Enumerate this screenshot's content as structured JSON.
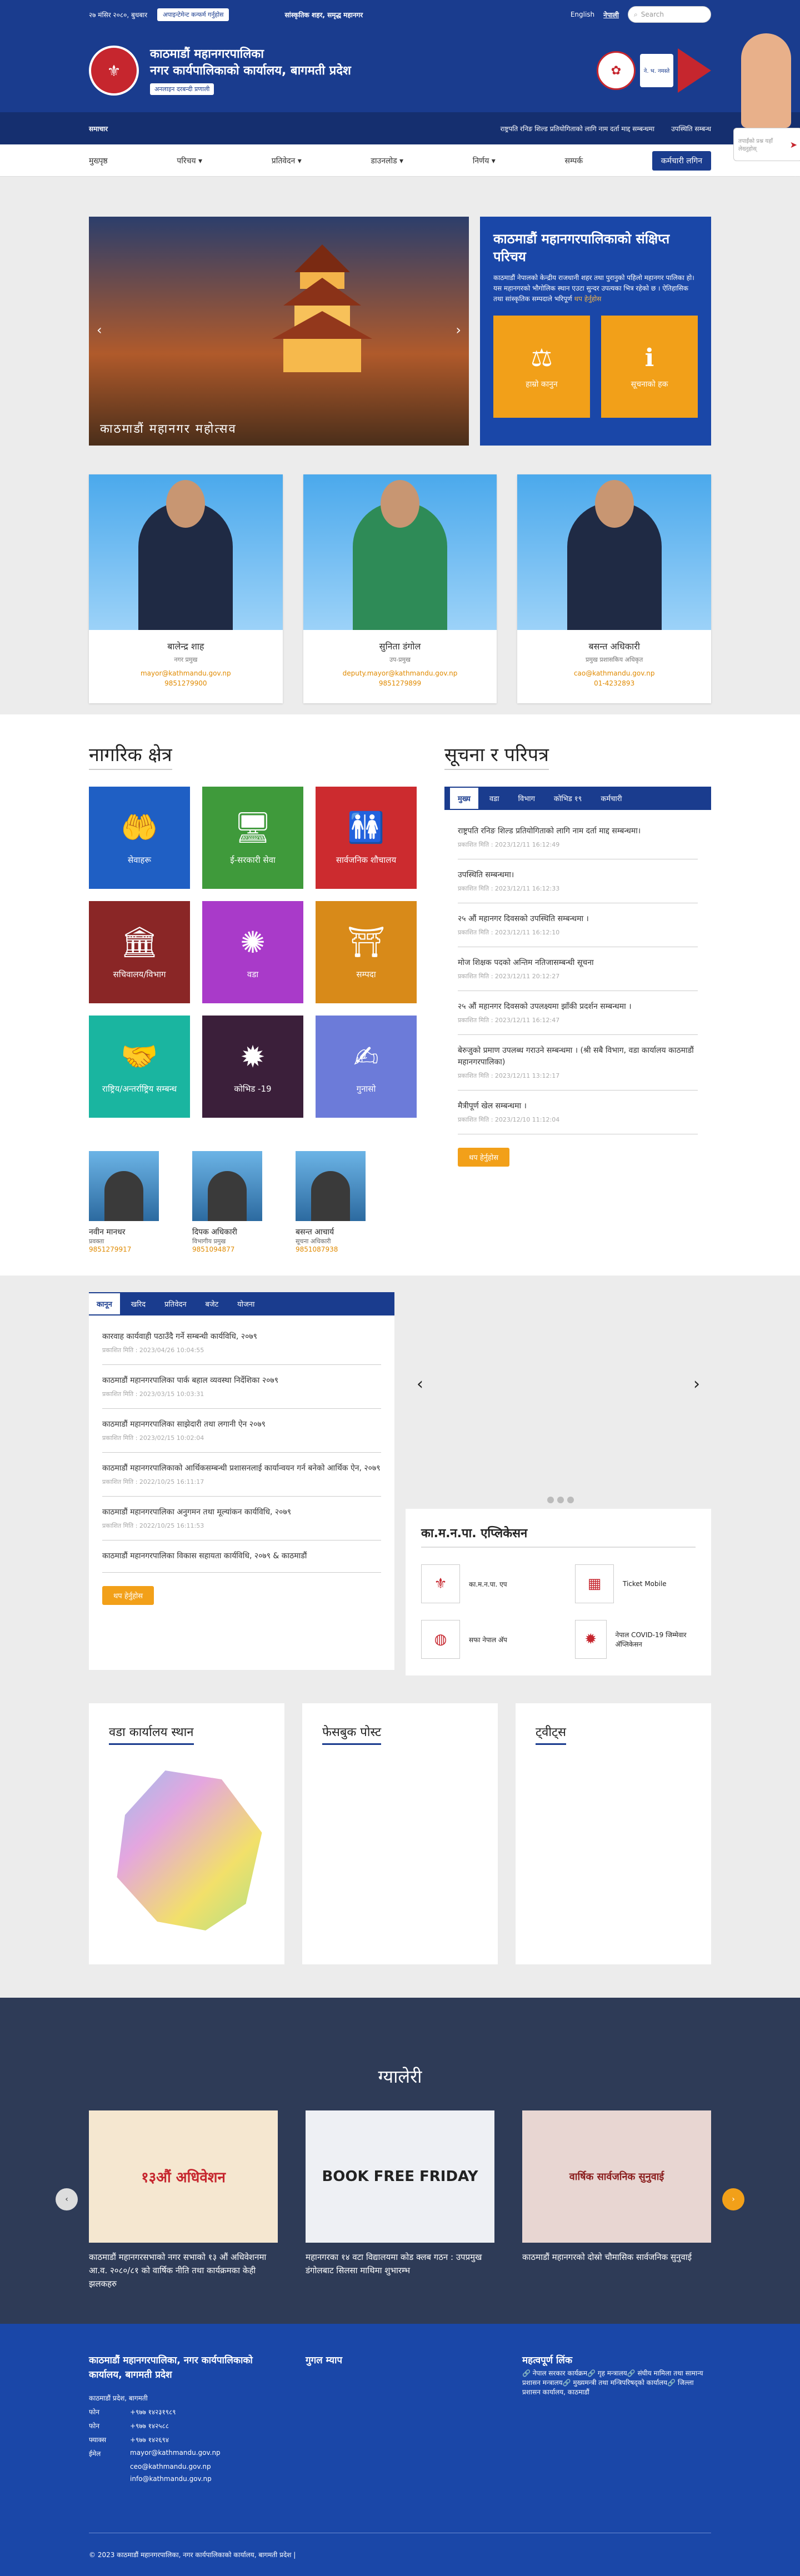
{
  "topbar": {
    "date": "२७ मंसिर २०८०, बुधबार",
    "appointment": "अपाइन्टेमेन्ट कन्फर्म गर्नुहोस",
    "tagline": "सांस्कृतिक शहर, समृद्ध महानगर",
    "english": "English",
    "nepali": "नेपाली",
    "search_placeholder": "Search"
  },
  "brand": {
    "line1": "काठमाडौं महानगरपालिका",
    "line2": "नगर कार्यपालिकाको कार्यालय, बागमती प्रदेश",
    "chip": "अनलाइन दरबन्दी प्रणाली",
    "pillar": "ने. भ. नमस्ते"
  },
  "ticker": {
    "label": "समाचार",
    "items": [
      "राष्ट्रपति रनिङ शिल्ड प्रतियोगिताको लागि नाम दर्ता माद्द सम्बन्धमा",
      "उपस्थिति सम्बन्ध"
    ]
  },
  "nav": [
    "मुख्पृष्ठ",
    "परिचय ▾",
    "प्रतिवेदन ▾",
    "डाउनलोड ▾",
    "निर्णय ▾",
    "सम्पर्क"
  ],
  "nav_login": "कर्मचारी लगिन",
  "slider": {
    "caption": "काठमाडौं महानगर महोत्सव"
  },
  "intro": {
    "title": "काठमाडौं महानगरपालिकाको संक्षिप्त परिचय",
    "text": "काठमाडौं नेपालको केन्द्रीय राजधानी शहर तथा पुरानुको पहिलो महानगर पालिका हो। यस महानगरको भौगोलिक स्थान एउटा सुन्दर उपत्यका भित्र रहेको छ । ऐतिहासिक तथा सांस्कृतिक सम्पदाले भरिपूर्ण",
    "more": "थप हेर्नुहोस",
    "box1": "हाम्रो कानुन",
    "box2": "सूचनाको हक"
  },
  "officials": [
    {
      "name": "बालेन्द्र शाह",
      "role": "नगर प्रमुख",
      "mail": "mayor@kathmandu.gov.np",
      "phone": "9851279900"
    },
    {
      "name": "सुनिता डंगोल",
      "role": "उप-प्रमुख",
      "mail": "deputy.mayor@kathmandu.gov.np",
      "phone": "9851279899"
    },
    {
      "name": "बसन्त अधिकारी",
      "role": "प्रमुख प्रशासकिय अधिकृत",
      "mail": "cao@kathmandu.gov.np",
      "phone": "01-4232893"
    }
  ],
  "helper": {
    "placeholder": "तपाईंको प्रश्न यहाँ लेख्नुहोस्"
  },
  "civic": {
    "title": "नागरिक क्षेत्र",
    "tiles": [
      {
        "label": "सेवाहरू",
        "icon": "🤲",
        "color": "#1f5fc4"
      },
      {
        "label": "ई-सरकारी सेवा",
        "icon": "🖥",
        "color": "#3f9a3b"
      },
      {
        "label": "सार्वजनिक शौचालय",
        "icon": "🚻",
        "color": "#cc2b2f"
      },
      {
        "label": "सचिवालय/विभाग",
        "icon": "🏛",
        "color": "#8a2626"
      },
      {
        "label": "वडा",
        "icon": "✺",
        "color": "#a93ac9"
      },
      {
        "label": "सम्पदा",
        "icon": "⛩",
        "color": "#d88a19"
      },
      {
        "label": "राष्ट्रिय/अन्तर्राष्ट्रिय सम्बन्ध",
        "icon": "🤝",
        "color": "#1ab5a0"
      },
      {
        "label": "कोभिड -19",
        "icon": "✹",
        "color": "#3b1f3a"
      },
      {
        "label": "गुनासो",
        "icon": "✍",
        "color": "#6c7bd9"
      }
    ],
    "staff": [
      {
        "name": "नवीन मानधर",
        "role": "प्रवक्ता",
        "tel": "9851279917"
      },
      {
        "name": "दिपक अधिकारी",
        "role": "विभागीय प्रमुख",
        "tel": "9851094877"
      },
      {
        "name": "बसन्त आचार्य",
        "role": "सूचना अधिकारी",
        "tel": "9851087938"
      }
    ]
  },
  "notice": {
    "title": "सूचना र परिपत्र",
    "tabs": [
      "मुख्य",
      "वडा",
      "विभाग",
      "कोभिड १९",
      "कर्मचारी"
    ],
    "items": [
      {
        "t": "राष्ट्रपति रनिङ शिल्ड प्रतियोगिताको लागि नाम दर्ता माद्द सम्बन्धमा।",
        "d": "प्रकाशित मिति : 2023/12/11 16:12:49"
      },
      {
        "t": "उपस्थिति सम्बन्धमा।",
        "d": "प्रकाशित मिति : 2023/12/11 16:12:33"
      },
      {
        "t": "२५ औं महानगर दिवसको उपस्थिति सम्बन्धमा ।",
        "d": "प्रकाशित मिति : 2023/12/11 16:12:10"
      },
      {
        "t": "मोज शिक्षक पदको अन्तिम नतिजासम्बन्धी सूचना",
        "d": "प्रकाशित मिति : 2023/12/11 20:12:27"
      },
      {
        "t": "२५ औं महानगर दिवसको उपलक्ष्यमा झाँकी प्रदर्शन सम्बन्धमा ।",
        "d": "प्रकाशित मिति : 2023/12/11 16:12:47"
      },
      {
        "t": "बेरुजुको प्रमाण उपलब्ध गराउने सम्बन्धमा । (श्री सबै विभाग, वडा कार्यालय काठमाडौं महानगरपालिका)",
        "d": "प्रकाशित मिति : 2023/12/11 13:12:17"
      },
      {
        "t": "मैत्रीपूर्ण खेल सम्बन्धमा ।",
        "d": "प्रकाशित मिति : 2023/12/10 11:12:04"
      }
    ],
    "more": "थप हेर्नुहोस"
  },
  "law": {
    "tabs": [
      "कानून",
      "खरिद",
      "प्रतिवेदन",
      "बजेट",
      "योजना"
    ],
    "items": [
      {
        "t": "कारवाह कार्यवाही पठाउँदै गर्ने सम्बन्धी कार्यविधि, २०७९",
        "d": "प्रकाशित मिति : 2023/04/26 10:04:55"
      },
      {
        "t": "काठमाडौं महानगरपालिका पार्क बहाल व्यवस्था निर्देशिका २०७९",
        "d": "प्रकाशित मिति : 2023/03/15 10:03:31"
      },
      {
        "t": "काठमाडौं महानगरपालिका साझेदारी तथा लगानी ऐन २०७९",
        "d": "प्रकाशित मिति : 2023/02/15 10:02:04"
      },
      {
        "t": "काठमाडौं महानगरपालिकाको आर्थिकसम्बन्धी प्रशासनलाई कार्यान्वयन गर्न बनेको आर्थिक ऐन, २०७९",
        "d": "प्रकाशित मिति : 2022/10/25 16:11:17"
      },
      {
        "t": "काठमाडौं महानगरपालिका अनुगमन तथा मूल्यांकन कार्यविधि, २०७९",
        "d": "प्रकाशित मिति : 2022/10/25 16:11:53"
      },
      {
        "t": "काठमाडौं महानगरपालिका विकास सहायता कार्यविधि, २०७९ & काठमाडौं",
        "d": ""
      }
    ],
    "more": "थप हेर्नुहोस"
  },
  "apps": {
    "title": "का.म.न.पा. एप्लिकेसन",
    "items": [
      "का.म.न.पा. एप",
      "Ticket Mobile",
      "सफा नेपाल अ‍ॅप",
      "नेपाल COVID-19 जिम्मेवार अ‍ॅप्लिकेसन"
    ]
  },
  "panels": [
    "वडा कार्यालय स्थान",
    "फेसबुक पोस्ट",
    "ट्वीट्स"
  ],
  "gallery": {
    "title": "ग्यालेरी",
    "items": [
      {
        "img": "१३औं अधिवेशन",
        "t": "काठमाडौं महानगरसभाको नगर सभाको १३ औं अधिवेशनमा आ.व. २०८०/८१ को वार्षिक नीति तथा कार्यक्रमका केही झलकहरु"
      },
      {
        "img": "BOOK FREE FRIDAY",
        "t": "महानगरका १४ वटा विद्यालयमा कोड क्लब गठन : उपप्रमुख डंगोलबाट सिलसा माथिमा शुभारम्भ"
      },
      {
        "img": "वार्षिक सार्वजनिक सुनुवाई",
        "t": "काठमाडौं महानगरको दोस्रो चौमासिक सार्वजनिक सुनुवाई"
      }
    ]
  },
  "footer": {
    "col1_title": "काठमाडौं महानगरपालिका, नगर कार्यपालिकाको कार्यालय, बागमती प्रदेश",
    "address": "काठमाडौं प्रदेश, बागमती",
    "lines": [
      [
        "फोन",
        "+९७७ १४२३१९८९"
      ],
      [
        "फोन",
        "+९७७ १४२५८८"
      ],
      [
        "फ्याक्स",
        "+९७७ १४२६९४"
      ],
      [
        "ईमेल",
        "mayor@kathmandu.gov.np"
      ],
      [
        "",
        "ceo@kathmandu.gov.np"
      ],
      [
        "",
        "info@kathmandu.gov.np"
      ]
    ],
    "col2_title": "गुगल म्याप",
    "col3_title": "महत्वपूर्ण लिंक",
    "links": [
      "नेपाल सरकार कार्यक्रम",
      "गृह मन्त्रालय",
      "संघीय मामिला तथा सामान्य प्रशासन मन्त्रालय",
      "मुख्यमन्त्री तथा मन्त्रिपरिषद्को कार्यालय",
      "जिल्ला प्रशासन कार्यालय, काठमाडौं"
    ],
    "copyright": "© 2023 काठमाडौं महानगरपालिका, नगर कार्यपालिकाको कार्यालय, बागमती प्रदेश |"
  }
}
